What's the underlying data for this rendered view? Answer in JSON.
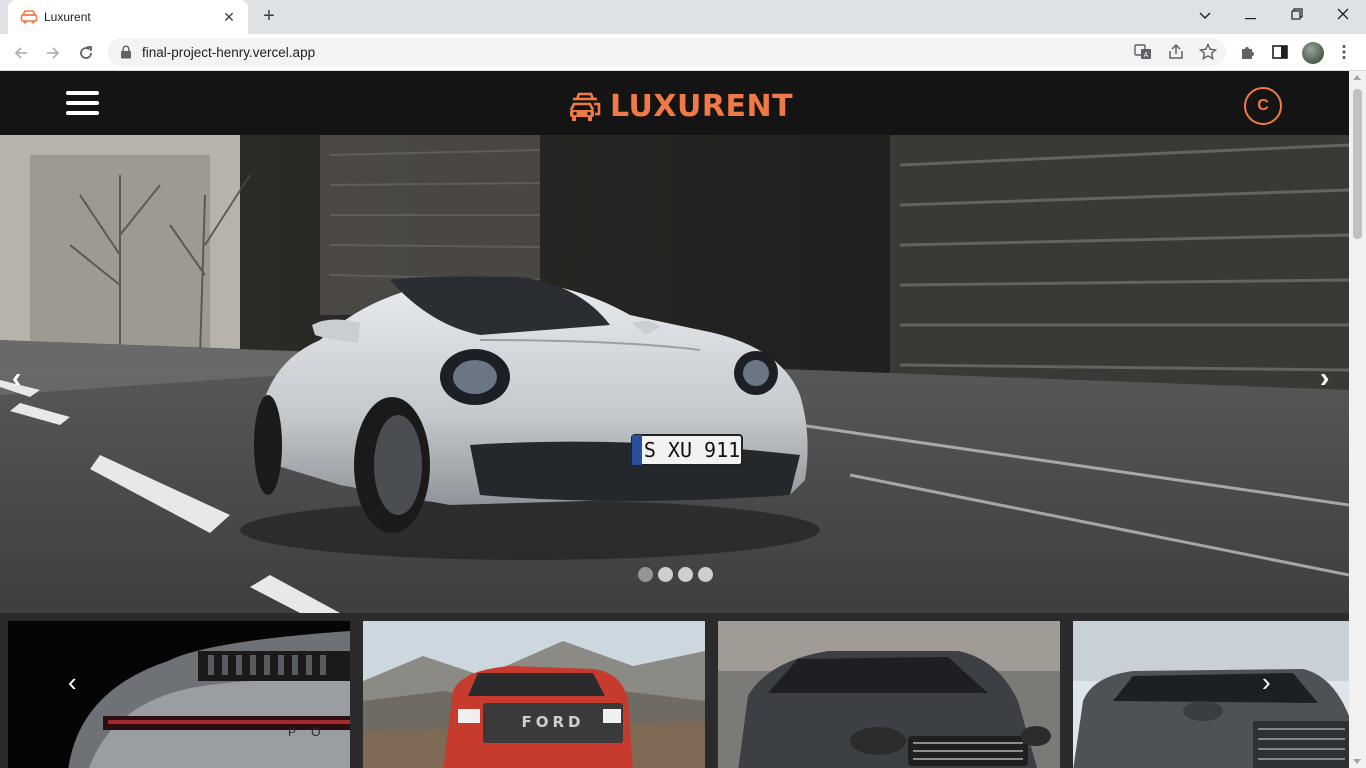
{
  "browser": {
    "tab_title": "Luxurent",
    "url": "final-project-henry.vercel.app",
    "new_tab_label": "+",
    "close_tab_label": "✕"
  },
  "header": {
    "logo_text": "LUXURENT",
    "user_initial": "C"
  },
  "hero": {
    "plate_text": "S XU 911",
    "prev_label": "‹",
    "next_label": "›",
    "slide_count": 4,
    "active_slide": 1
  },
  "cards": {
    "prev_label": "‹",
    "next_label": "›",
    "items": [
      {
        "name": "porsche-911-rear",
        "badge": "P O"
      },
      {
        "name": "ford-raptor",
        "badge": "FORD"
      },
      {
        "name": "mazda-cx9",
        "badge": ""
      },
      {
        "name": "lexus-gx",
        "badge": ""
      }
    ]
  },
  "colors": {
    "accent": "#ef7a45",
    "header_bg": "#141414",
    "page_bg": "#222222"
  }
}
